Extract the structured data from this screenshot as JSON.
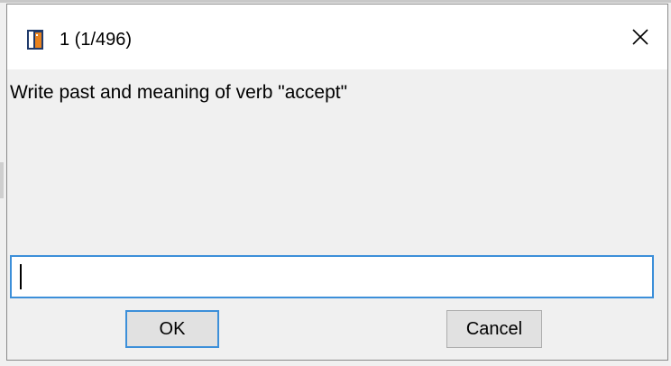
{
  "window": {
    "title": "1 (1/496)",
    "app_icon": "app-book-icon",
    "close_icon": "close-icon"
  },
  "prompt": {
    "text": "Write past and meaning of verb \"accept\""
  },
  "answer": {
    "value": "",
    "placeholder": ""
  },
  "buttons": {
    "ok_label": "OK",
    "cancel_label": "Cancel"
  },
  "colors": {
    "focus_accent": "#3c8fd9",
    "dialog_background": "#f0f0f0",
    "titlebar_background": "#ffffff",
    "icon_orange": "#e8821e",
    "icon_navy": "#1f3a6b"
  }
}
